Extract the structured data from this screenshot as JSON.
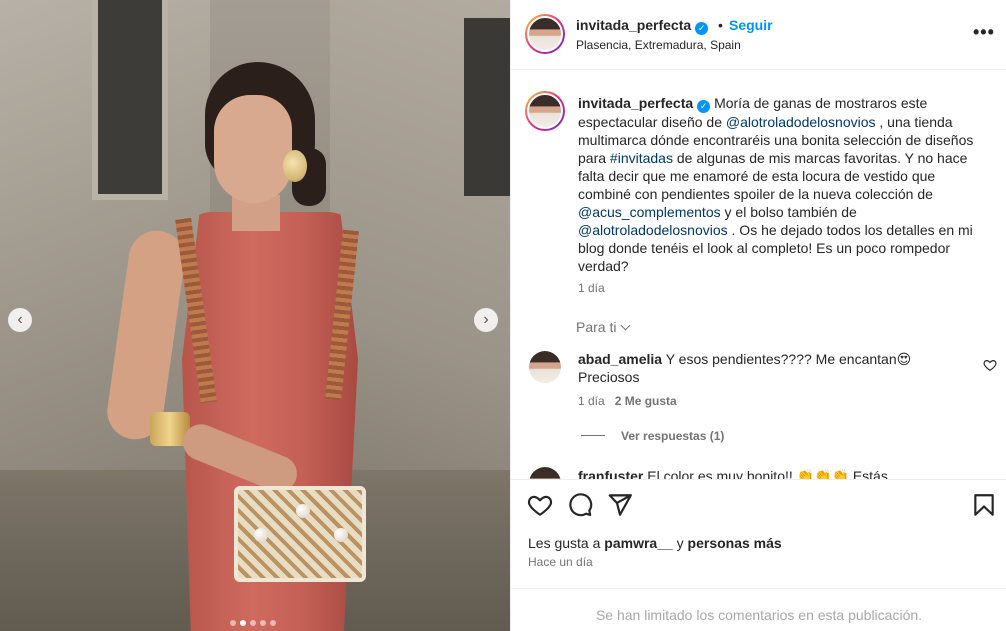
{
  "post": {
    "username": "invitada_perfecta",
    "follow_label": "Seguir",
    "separator": "•",
    "location": "Plasencia, Extremadura, Spain",
    "verified_icon": "verified-badge-icon",
    "more_icon": "more-options-icon"
  },
  "caption": {
    "username": "invitada_perfecta",
    "part1": "Moría de ganas de mostraros este espectacular diseño de ",
    "mention1": "@alotroladodelosnovios",
    "part2": " , una tienda multimarca dónde encontraréis una bonita selección de diseños para ",
    "hashtag1": "#invitadas",
    "part3": " de algunas de mis marcas favoritas. Y no hace falta decir que me enamoré de esta locura de vestido que combiné con pendientes spoiler de la nueva colección de ",
    "mention2": "@acus_complementos",
    "part4": " y el bolso también de ",
    "mention3": "@alotroladodelosnovios",
    "part5": " . Os he dejado todos los detalles en mi blog donde tenéis el look al completo! Es un poco rompedor verdad?",
    "time": "1 día"
  },
  "comments_filter": "Para ti",
  "comments": [
    {
      "username": "abad_amelia",
      "text": " Y esos pendientes???? Me encantan😍 Preciosos",
      "time": "1 día",
      "likes": "2 Me gusta",
      "replies": "Ver respuestas (1)"
    },
    {
      "username": "franfuster",
      "text": " El color es muy bonito!! 👏👏👏 Estás"
    }
  ],
  "likes": {
    "prefix": "Les gusta a ",
    "user": "pamwra__",
    "conj": " y ",
    "others": "personas más"
  },
  "posted": "Hace un día",
  "limited_notice": "Se han limitado los comentarios en esta publicación.",
  "carousel": {
    "prev": "‹",
    "next": "›",
    "total_images": 5,
    "current_image": 2
  },
  "colors": {
    "link": "#00376b",
    "follow": "#0095f6",
    "muted": "#737373",
    "dress": "#cf6a5e"
  }
}
